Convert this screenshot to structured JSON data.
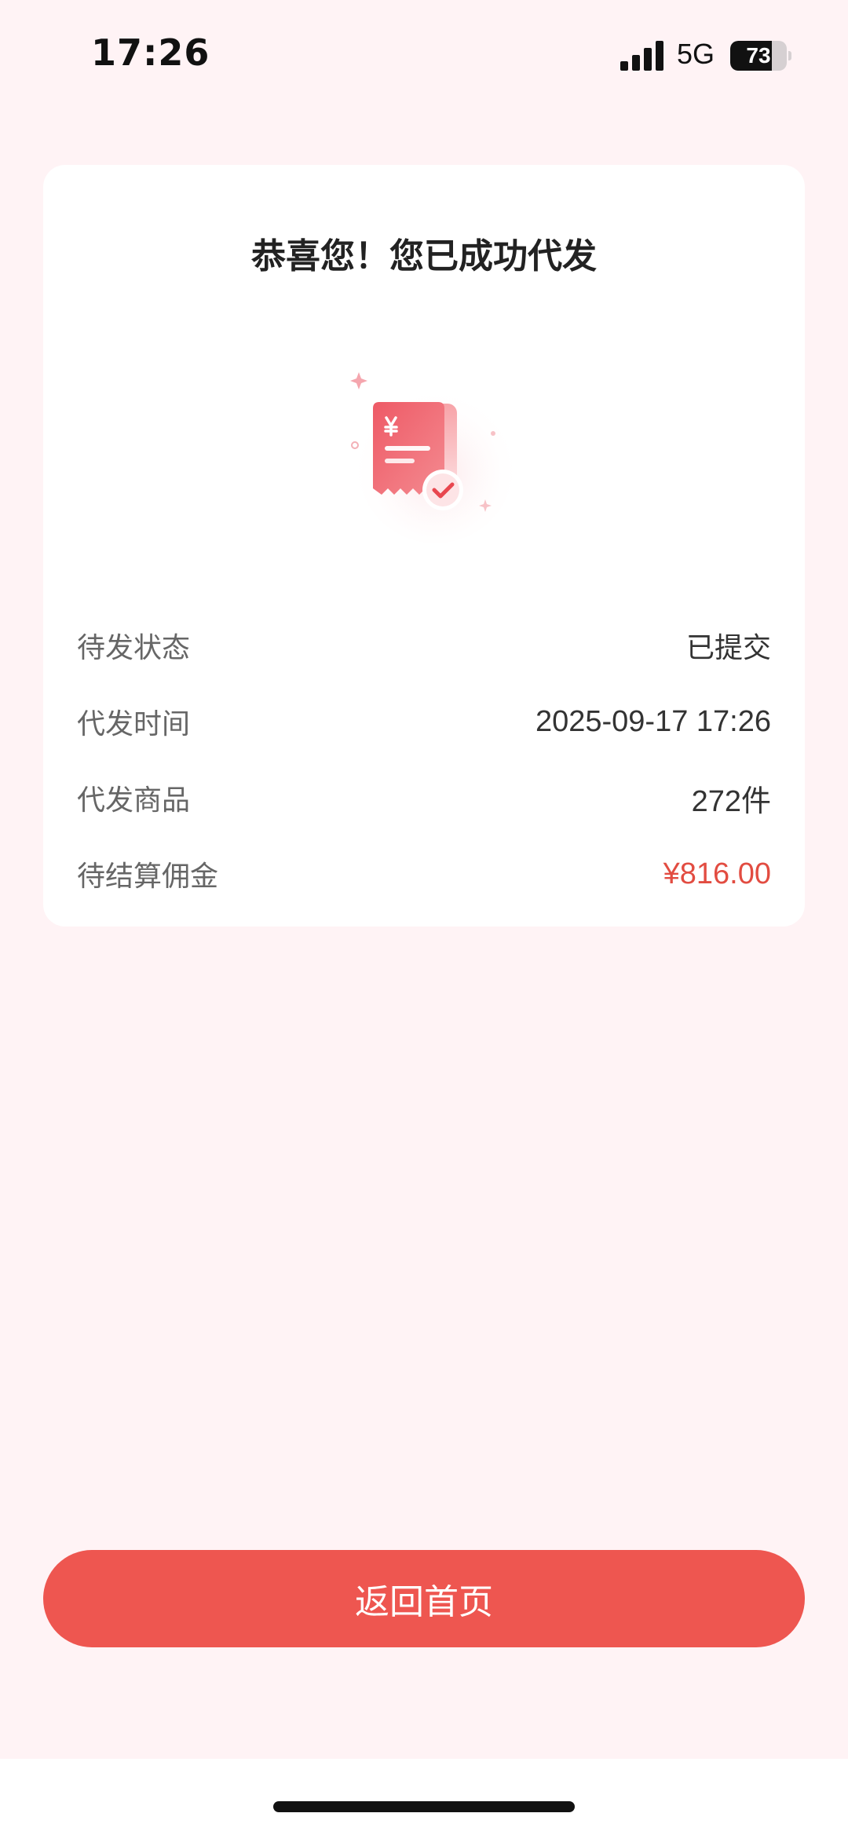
{
  "status_bar": {
    "time": "17:26",
    "network": "5G",
    "battery_level": "73",
    "battery_fraction": 0.73
  },
  "card": {
    "title": "恭喜您！您已成功代发",
    "illustration_icon": "receipt-check-icon",
    "rows": [
      {
        "label": "待发状态",
        "value": "已提交"
      },
      {
        "label": "代发时间",
        "value": "2025-09-17 17:26"
      },
      {
        "label": "代发商品",
        "value": "272件"
      },
      {
        "label": "待结算佣金",
        "value": "¥816.00"
      }
    ]
  },
  "button": {
    "label": "返回首页"
  },
  "colors": {
    "accent": "#ee5650",
    "commission": "#e24c41",
    "page_background": "#fff3f5"
  }
}
